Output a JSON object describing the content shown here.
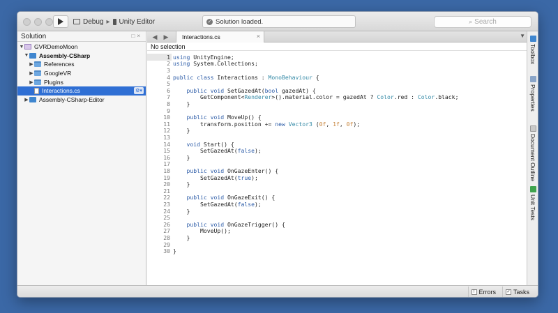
{
  "toolbar": {
    "config": "Debug",
    "target": "Unity Editor",
    "status": "Solution loaded.",
    "search_placeholder": "Search"
  },
  "sidebar": {
    "title": "Solution",
    "items": [
      {
        "label": "GVRDemoMoon",
        "icon": "solution-icon",
        "expanded": true
      },
      {
        "label": "Assembly-CSharp",
        "icon": "project-icon",
        "expanded": true
      },
      {
        "label": "References",
        "icon": "folder-icon",
        "expanded": false
      },
      {
        "label": "GoogleVR",
        "icon": "folder-icon",
        "expanded": false
      },
      {
        "label": "Plugins",
        "icon": "folder-icon",
        "expanded": false
      },
      {
        "label": "Interactions.cs",
        "icon": "file-icon",
        "selected": true
      },
      {
        "label": "Assembly-CSharp-Editor",
        "icon": "project-icon",
        "expanded": false
      }
    ]
  },
  "editor": {
    "tab": "Interactions.cs",
    "breadcrumb": "No selection",
    "current_line": 1,
    "lines": [
      "using UnityEngine;",
      "using System.Collections;",
      "",
      "public class Interactions : MonoBehaviour {",
      "",
      "    public void SetGazedAt(bool gazedAt) {",
      "        GetComponent<Renderer>().material.color = gazedAt ? Color.red : Color.black;",
      "    }",
      "",
      "    public void MoveUp() {",
      "        transform.position += new Vector3 (0f, 1f, 0f);",
      "    }",
      "",
      "    void Start() {",
      "        SetGazedAt(false);",
      "    }",
      "",
      "    public void OnGazeEnter() {",
      "        SetGazedAt(true);",
      "    }",
      "",
      "    public void OnGazeExit() {",
      "        SetGazedAt(false);",
      "    }",
      "",
      "    public void OnGazeTrigger() {",
      "        MoveUp();",
      "    }",
      "",
      "}"
    ]
  },
  "right_panel": {
    "items": [
      {
        "label": "Toolbox",
        "icon": "toolbox-icon"
      },
      {
        "label": "Properties",
        "icon": "properties-icon"
      },
      {
        "label": "Document Outline",
        "icon": "outline-icon"
      },
      {
        "label": "Unit Tests",
        "icon": "unit-tests-icon"
      }
    ]
  },
  "statusbar": {
    "errors": "Errors",
    "tasks": "Tasks"
  },
  "colors": {
    "desktop": "#3b68a6",
    "selection": "#2f6fd4",
    "keyword": "#2b5ba7",
    "type": "#3389a6",
    "number": "#c7833a"
  }
}
